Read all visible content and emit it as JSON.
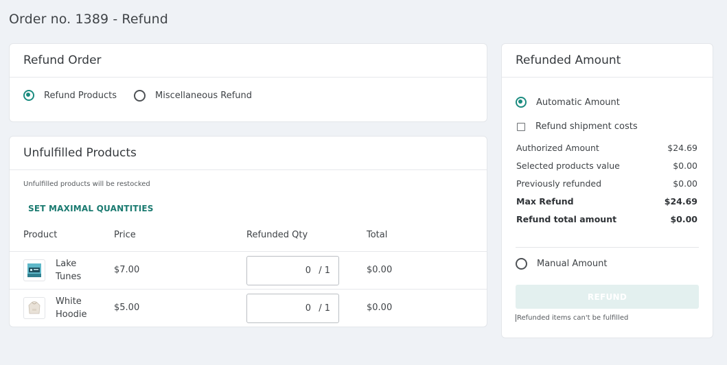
{
  "page": {
    "title": "Order no. 1389 - Refund"
  },
  "refund_order": {
    "title": "Refund Order",
    "options": [
      {
        "label": "Refund Products",
        "selected": true
      },
      {
        "label": "Miscellaneous Refund",
        "selected": false
      }
    ]
  },
  "unfulfilled": {
    "title": "Unfulfilled Products",
    "note": "Unfulfilled products will be restocked",
    "set_max_label": "SET MAXIMAL QUANTITIES",
    "columns": [
      "Product",
      "Price",
      "Refunded Qty",
      "Total"
    ],
    "rows": [
      {
        "name": "Lake Tunes",
        "price": "$7.00",
        "qty": "0",
        "max": "/ 1",
        "total": "$0.00",
        "thumb_icon": "album-cover-icon"
      },
      {
        "name": "White Hoodie",
        "price": "$5.00",
        "qty": "0",
        "max": "/ 1",
        "total": "$0.00",
        "thumb_icon": "hoodie-icon"
      }
    ]
  },
  "refunded_amount": {
    "title": "Refunded Amount",
    "automatic_label": "Automatic Amount",
    "automatic_selected": true,
    "shipment_label": "Refund shipment costs",
    "shipment_checked": false,
    "rows": [
      {
        "label": "Authorized Amount",
        "value": "$24.69",
        "bold": false
      },
      {
        "label": "Selected products value",
        "value": "$0.00",
        "bold": false
      },
      {
        "label": "Previously refunded",
        "value": "$0.00",
        "bold": false
      },
      {
        "label": "Max Refund",
        "value": "$24.69",
        "bold": true
      },
      {
        "label": "Refund total amount",
        "value": "$0.00",
        "bold": true
      }
    ],
    "manual_label": "Manual Amount",
    "manual_selected": false,
    "refund_button": "REFUND",
    "footer_note": "Refunded items can't be fulfilled"
  },
  "colors": {
    "accent": "#1a8b7f",
    "background": "#eff2f6",
    "button_disabled": "#e3f0ef"
  }
}
